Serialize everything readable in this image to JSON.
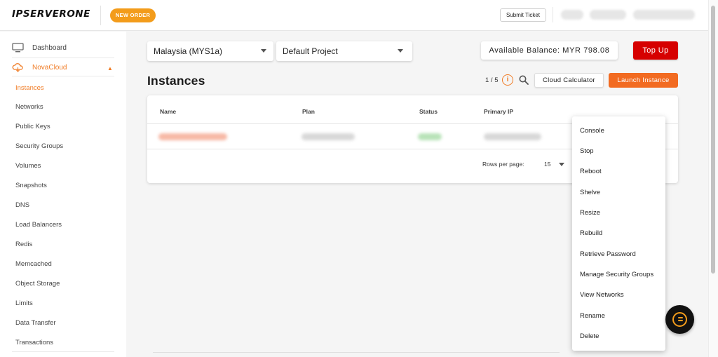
{
  "header": {
    "logo_text": "IPSERVERONE",
    "new_order_label": "NEW ORDER",
    "submit_ticket_label": "Submit Ticket"
  },
  "sidebar": {
    "dashboard_label": "Dashboard",
    "novacloud_label": "NovaCloud",
    "items": [
      {
        "label": "Instances",
        "active": true
      },
      {
        "label": "Networks"
      },
      {
        "label": "Public Keys"
      },
      {
        "label": "Security Groups"
      },
      {
        "label": "Volumes"
      },
      {
        "label": "Snapshots"
      },
      {
        "label": "DNS"
      },
      {
        "label": "Load Balancers"
      },
      {
        "label": "Redis"
      },
      {
        "label": "Memcached"
      },
      {
        "label": "Object Storage"
      },
      {
        "label": "Limits"
      },
      {
        "label": "Data Transfer"
      },
      {
        "label": "Transactions"
      }
    ]
  },
  "toolbar": {
    "region_value": "Malaysia (MYS1a)",
    "project_value": "Default Project",
    "balance_text": "Available Balance: MYR 798.08",
    "topup_label": "Top Up"
  },
  "page": {
    "title": "Instances",
    "counter": "1 / 5",
    "cloud_calculator_label": "Cloud Calculator",
    "launch_label": "Launch Instance"
  },
  "table": {
    "columns": [
      "Name",
      "Plan",
      "Status",
      "Primary IP"
    ],
    "rows_per_page_label": "Rows per page:",
    "rows_per_page_value": "15"
  },
  "menu": {
    "items": [
      "Console",
      "Stop",
      "Reboot",
      "Shelve",
      "Resize",
      "Rebuild",
      "Retrieve Password",
      "Manage Security Groups",
      "View Networks",
      "Rename",
      "Delete"
    ]
  },
  "colors": {
    "accent_orange": "#f07b24",
    "new_order": "#f39c1b",
    "topup_red": "#d60000",
    "launch_orange": "#f26b21"
  }
}
